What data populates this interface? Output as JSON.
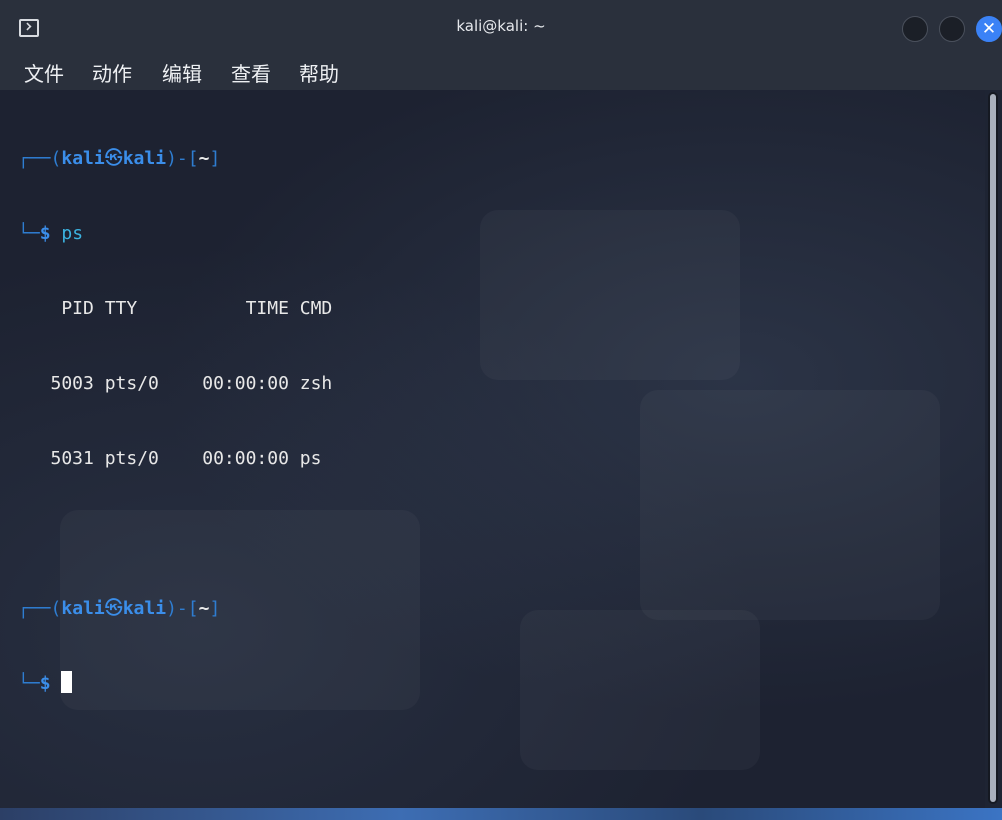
{
  "window": {
    "title": "kali@kali: ~",
    "app_icon": "terminal-icon",
    "controls": {
      "minimize_icon": "minimize-icon",
      "maximize_icon": "maximize-icon",
      "close_symbol": "✕"
    }
  },
  "menu": {
    "items": [
      "文件",
      "动作",
      "编辑",
      "查看",
      "帮助"
    ]
  },
  "terminal": {
    "prompt1": {
      "frame_top": "┌──(",
      "user": "kali",
      "at": "㉿",
      "host": "kali",
      "mid": ")-[",
      "dir": "~",
      "end": "]",
      "frame_bottom": "└─",
      "dollar": "$",
      "command": "ps"
    },
    "output": {
      "header": "    PID TTY          TIME CMD",
      "rows": [
        "   5003 pts/0    00:00:00 zsh",
        "   5031 pts/0    00:00:00 ps"
      ]
    },
    "prompt2": {
      "frame_top": "┌──(",
      "user": "kali",
      "at": "㉿",
      "host": "kali",
      "mid": ")-[",
      "dir": "~",
      "end": "]",
      "frame_bottom": "└─",
      "dollar": "$"
    }
  },
  "colors": {
    "prompt_blue": "#3b8eea",
    "command_cyan": "#3bb3e0",
    "background": "#1d2231",
    "titlebar": "#2a303c"
  }
}
